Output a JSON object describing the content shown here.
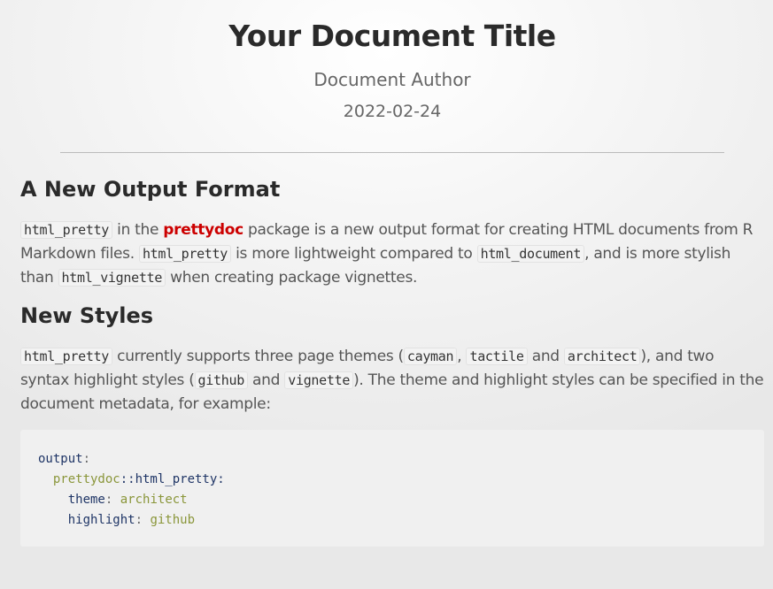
{
  "header": {
    "title": "Your Document Title",
    "author": "Document Author",
    "date": "2022-02-24"
  },
  "sections": [
    {
      "heading": "A New Output Format",
      "p": {
        "c1": "html_pretty",
        "t1": " in the ",
        "link": "prettydoc",
        "t2": " package is a new output format for creating HTML documents from R Markdown files. ",
        "c2": "html_pretty",
        "t3": " is more lightweight compared to ",
        "c3": "html_document",
        "t4": ", and is more stylish than ",
        "c4": "html_vignette",
        "t5": " when creating package vignettes."
      }
    },
    {
      "heading": "New Styles",
      "p": {
        "c1": "html_pretty",
        "t1": " currently supports three page themes (",
        "c2": "cayman",
        "t2": ", ",
        "c3": "tactile",
        "t3": " and ",
        "c4": "architect",
        "t4": "), and two syntax highlight styles (",
        "c5": "github",
        "t5": " and ",
        "c6": "vignette",
        "t6": "). The theme and highlight styles can be specified in the document metadata, for example:"
      },
      "code": {
        "l1k": "output",
        "colon": ":",
        "l2a": "prettydoc",
        "l2b": "::html_pretty:",
        "l3k": "theme",
        "l3v": "architect",
        "l4k": "highlight",
        "l4v": "github"
      }
    }
  ]
}
